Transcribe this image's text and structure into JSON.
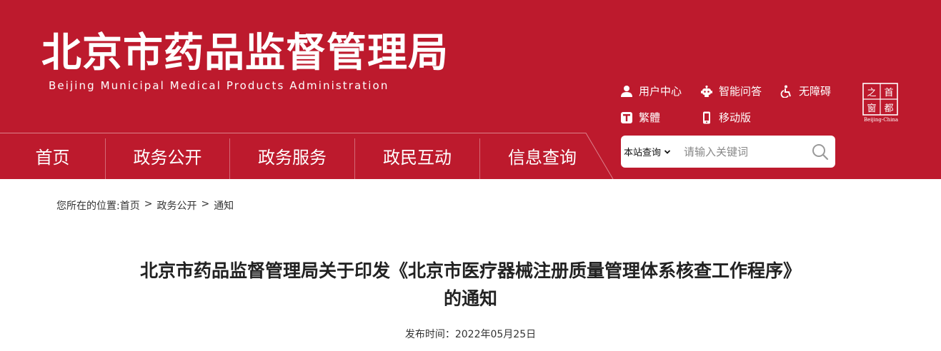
{
  "header": {
    "title_cn": "北京市药品监督管理局",
    "title_en": "Beijing Municipal Medical Products Administration",
    "brand_color": "#bd1a2d"
  },
  "top_links": [
    {
      "label": "用户中心",
      "icon": "user-icon"
    },
    {
      "label": "智能问答",
      "icon": "robot-icon"
    },
    {
      "label": "无障碍",
      "icon": "accessibility-icon"
    },
    {
      "label": "繁體",
      "icon": "traditional-chinese-icon"
    },
    {
      "label": "移动版",
      "icon": "mobile-icon"
    }
  ],
  "logo": {
    "chars": [
      "之",
      "首",
      "窗",
      "都"
    ],
    "caption": "Beijing-China"
  },
  "nav": [
    {
      "label": "首页"
    },
    {
      "label": "政务公开"
    },
    {
      "label": "政务服务"
    },
    {
      "label": "政民互动"
    },
    {
      "label": "信息查询"
    }
  ],
  "search": {
    "scope": "本站查询",
    "placeholder": "请输入关键词"
  },
  "breadcrumb": {
    "prefix": "您所在的位置:",
    "items": [
      "首页",
      "政务公开",
      "通知"
    ],
    "separator": ">"
  },
  "article": {
    "title_line1": "北京市药品监督管理局关于印发《北京市医疗器械注册质量管理体系核查工作程序》",
    "title_line2": "的通知",
    "publish_label": "发布时间：",
    "publish_date": "2022年05月25日"
  }
}
